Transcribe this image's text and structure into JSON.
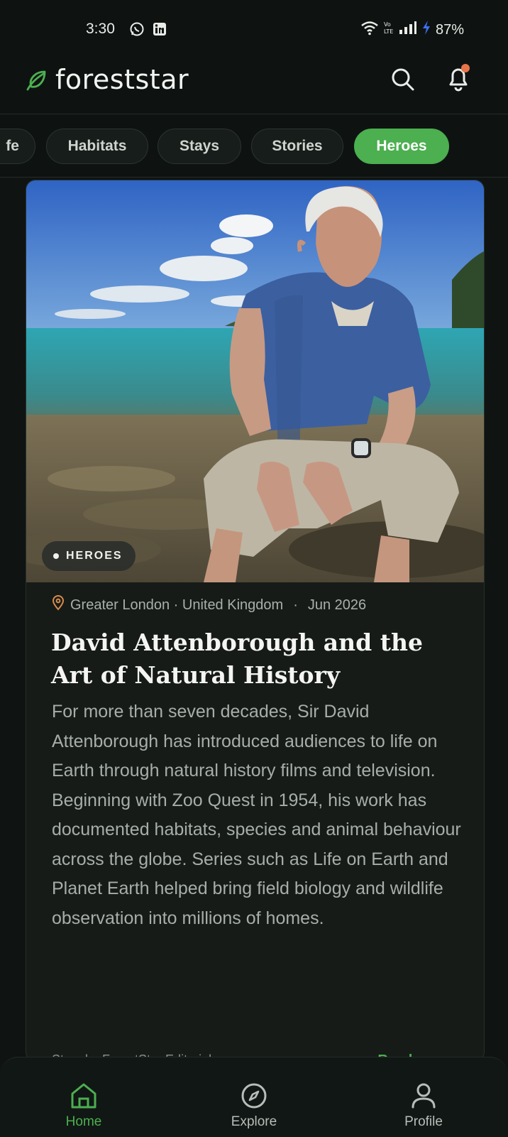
{
  "status_bar": {
    "time": "3:30",
    "battery": "87%",
    "icons": [
      "whatsapp-icon",
      "linkedin-icon",
      "wifi-icon",
      "volte-icon",
      "signal-icon",
      "charging-icon"
    ]
  },
  "header": {
    "brand": "foreststar",
    "icons": [
      "leaf-icon",
      "search-icon",
      "bell-icon"
    ],
    "notification_dot_color": "#e8744a"
  },
  "categories": {
    "items": [
      "fe",
      "Habitats",
      "Stays",
      "Stories",
      "Heroes"
    ],
    "active": "Heroes"
  },
  "article": {
    "badge": "HEROES",
    "location": "Greater London · United Kingdom",
    "separator": "·",
    "date": "Jun 2026",
    "title": "David Attenborough and the Art of Natural History",
    "body": "For more than seven decades, Sir David Attenborough has introduced audiences to life on Earth through natural history films and television. Beginning with Zoo Quest in 1954, his work has documented habitats, species and animal behaviour across the globe. Series such as Life on Earth and Planet Earth helped bring field biology and wildlife observation into millions of homes.",
    "byline": "Story by ForestStar Editorial",
    "read_more": "Read more"
  },
  "bottom_nav": {
    "items": [
      {
        "label": "Home",
        "icon": "home-icon",
        "active": true
      },
      {
        "label": "Explore",
        "icon": "compass-icon",
        "active": false
      },
      {
        "label": "Profile",
        "icon": "profile-icon",
        "active": false
      }
    ]
  },
  "colors": {
    "accent": "#4caf50",
    "background": "#0f1412",
    "card": "#161b18"
  }
}
